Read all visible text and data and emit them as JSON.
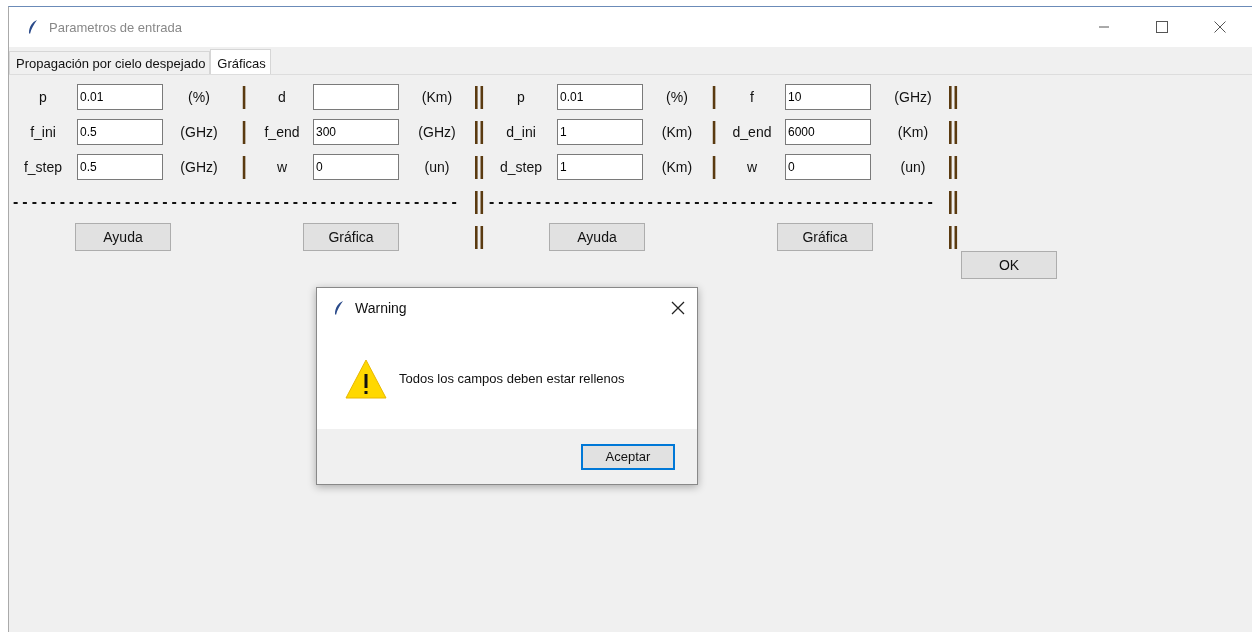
{
  "window": {
    "title": "Parametros de entrada"
  },
  "tabs": [
    {
      "label": "Propagación por cielo despejado",
      "selected": false
    },
    {
      "label": "Gráficas",
      "selected": true
    }
  ],
  "panels": [
    {
      "rows": [
        [
          {
            "kind": "label",
            "text": "p"
          },
          {
            "kind": "entry",
            "value": "0.01"
          },
          {
            "kind": "unit",
            "text": "(%)"
          },
          {
            "kind": "sep",
            "text": "|"
          },
          {
            "kind": "label",
            "text": "d"
          },
          {
            "kind": "entry"
          },
          {
            "kind": "unit",
            "text": "(Km)"
          },
          {
            "kind": "sep",
            "text": "||"
          }
        ],
        [
          {
            "kind": "label",
            "text": "f_ini"
          },
          {
            "kind": "entry",
            "value": "0.5"
          },
          {
            "kind": "unit",
            "text": "(GHz)"
          },
          {
            "kind": "sep",
            "text": "|"
          },
          {
            "kind": "label",
            "text": "f_end"
          },
          {
            "kind": "entry",
            "value": "300"
          },
          {
            "kind": "unit",
            "text": "(GHz)"
          },
          {
            "kind": "sep",
            "text": "||"
          }
        ],
        [
          {
            "kind": "label",
            "text": "f_step"
          },
          {
            "kind": "entry",
            "value": "0.5"
          },
          {
            "kind": "unit",
            "text": "(GHz)"
          },
          {
            "kind": "sep",
            "text": "|"
          },
          {
            "kind": "label",
            "text": "w"
          },
          {
            "kind": "entry",
            "value": "0"
          },
          {
            "kind": "unit",
            "text": "(un)"
          },
          {
            "kind": "sep",
            "text": "||"
          }
        ]
      ],
      "rule": "------------------------------------------------",
      "rule_sep": "||",
      "buttons": [
        "Ayuda",
        "Gráfica"
      ],
      "button_sep": "||"
    },
    {
      "rows": [
        [
          {
            "kind": "label",
            "text": "p"
          },
          {
            "kind": "entry",
            "value": "0.01"
          },
          {
            "kind": "unit",
            "text": "(%)"
          },
          {
            "kind": "sep",
            "text": "|"
          },
          {
            "kind": "label",
            "text": "f"
          },
          {
            "kind": "entry",
            "value": "10"
          },
          {
            "kind": "unit",
            "text": "(GHz)"
          },
          {
            "kind": "sep",
            "text": "||"
          }
        ],
        [
          {
            "kind": "label",
            "text": "d_ini"
          },
          {
            "kind": "entry",
            "value": "1"
          },
          {
            "kind": "unit",
            "text": "(Km)"
          },
          {
            "kind": "sep",
            "text": "|"
          },
          {
            "kind": "label",
            "text": "d_end"
          },
          {
            "kind": "entry",
            "value": "6000"
          },
          {
            "kind": "unit",
            "text": "(Km)"
          },
          {
            "kind": "sep",
            "text": "||"
          }
        ],
        [
          {
            "kind": "label",
            "text": "d_step"
          },
          {
            "kind": "entry",
            "value": "1"
          },
          {
            "kind": "unit",
            "text": "(Km)"
          },
          {
            "kind": "sep",
            "text": "|"
          },
          {
            "kind": "label",
            "text": "w"
          },
          {
            "kind": "entry",
            "value": "0"
          },
          {
            "kind": "unit",
            "text": "(un)"
          },
          {
            "kind": "sep",
            "text": "||"
          }
        ]
      ],
      "rule": "------------------------------------------------",
      "rule_sep": "||",
      "buttons": [
        "Ayuda",
        "Gráfica"
      ],
      "button_sep": "||"
    }
  ],
  "ok_button": "OK",
  "dialog": {
    "title": "Warning",
    "message": "Todos los campos deben estar rellenos",
    "button": "Aceptar"
  }
}
